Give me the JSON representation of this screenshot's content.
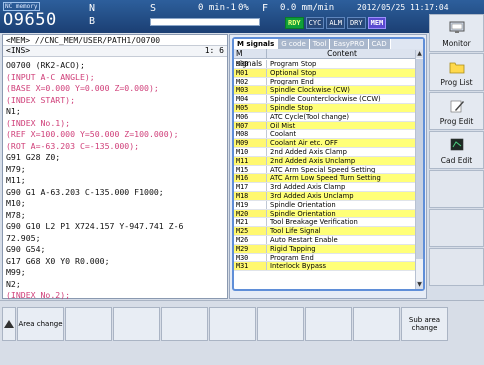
{
  "status": {
    "mem_tag": "NC memory",
    "program_no": "O9650",
    "axis_n": "N",
    "axis_b": "B",
    "axis_s": "S",
    "spindle": "0 min-1",
    "load": "0%",
    "axis_f": "F",
    "feed": "0.0 mm/min",
    "datetime": "2012/05/25 11:17:04",
    "indicators": [
      "RDY",
      "CYC",
      "ALM",
      "DRY",
      "MEM"
    ]
  },
  "program": {
    "path": "<MEM> //CNC_MEM/USER/PATH1/O0700",
    "ins": "<INS>",
    "position": "1:  6",
    "lines": [
      {
        "text": "O0700 (RK2-ACO);",
        "comment": false
      },
      {
        "text": "(INPUT A-C ANGLE);",
        "comment": true
      },
      {
        "text": "(BASE X=0.000 Y=0.000 Z=0.000);",
        "comment": true
      },
      {
        "text": "(INDEX START);",
        "comment": true
      },
      {
        "text": "N1;",
        "comment": false
      },
      {
        "text": "(INDEX No.1);",
        "comment": true
      },
      {
        "text": "(REF X=100.000 Y=50.000 Z=100.000);",
        "comment": true
      },
      {
        "text": "(ROT A=-63.203 C=-135.000);",
        "comment": true
      },
      {
        "text": "G91 G28 Z0;",
        "comment": false
      },
      {
        "text": "M79;",
        "comment": false
      },
      {
        "text": "M11;",
        "comment": false
      },
      {
        "text": "G90 G1 A-63.203 C-135.000 F1000;",
        "comment": false
      },
      {
        "text": "M10;",
        "comment": false
      },
      {
        "text": "M78;",
        "comment": false
      },
      {
        "text": "G90 G10 L2 P1 X724.157 Y-947.741 Z-6",
        "comment": false
      },
      {
        "text": "72.905;",
        "comment": false
      },
      {
        "text": "G90 G54;",
        "comment": false
      },
      {
        "text": "G17 G68 X0 Y0 R0.000;",
        "comment": false
      },
      {
        "text": "M99;",
        "comment": false
      },
      {
        "text": "N2;",
        "comment": false
      },
      {
        "text": "(INDEX No.2);",
        "comment": true
      }
    ]
  },
  "table": {
    "tabs": [
      "M signals",
      "G code",
      "Tool",
      "EasyPRO",
      "CAD"
    ],
    "headers": [
      "M signals",
      "Content"
    ],
    "rows": [
      {
        "code": "M00",
        "content": "Program Stop",
        "sel": false
      },
      {
        "code": "M01",
        "content": "Optional Stop",
        "sel": true
      },
      {
        "code": "M02",
        "content": "Program End",
        "sel": false
      },
      {
        "code": "M03",
        "content": "Spindle Clockwise (CW)",
        "sel": true
      },
      {
        "code": "M04",
        "content": "Spindle Counterclockwise (CCW)",
        "sel": false
      },
      {
        "code": "M05",
        "content": "Spindle Stop",
        "sel": true
      },
      {
        "code": "M06",
        "content": "ATC Cycle(Tool change)",
        "sel": false
      },
      {
        "code": "M07",
        "content": "Oil Mist",
        "sel": true
      },
      {
        "code": "M08",
        "content": "Coolant",
        "sel": false
      },
      {
        "code": "M09",
        "content": "Coolant Air etc. OFF",
        "sel": true
      },
      {
        "code": "M10",
        "content": "2nd Added Axis Clamp",
        "sel": false
      },
      {
        "code": "M11",
        "content": "2nd Added Axis Unclamp",
        "sel": true
      },
      {
        "code": "M15",
        "content": "ATC Arm Special Speed Setting",
        "sel": false
      },
      {
        "code": "M16",
        "content": "ATC Arm Low Speed Turn Setting",
        "sel": true
      },
      {
        "code": "M17",
        "content": "3rd Added Axis Clamp",
        "sel": false
      },
      {
        "code": "M18",
        "content": "3rd Added Axis Unclamp",
        "sel": true
      },
      {
        "code": "M19",
        "content": "Spindle Orientation",
        "sel": false
      },
      {
        "code": "M20",
        "content": "Spindle Orientation",
        "sel": true
      },
      {
        "code": "M21",
        "content": "Tool Breakage Verification",
        "sel": false
      },
      {
        "code": "M25",
        "content": "Tool Life Signal",
        "sel": true
      },
      {
        "code": "M26",
        "content": "Auto Restart Enable",
        "sel": false
      },
      {
        "code": "M29",
        "content": "Rigid Tapping",
        "sel": true
      },
      {
        "code": "M30",
        "content": "Program End",
        "sel": false
      },
      {
        "code": "M31",
        "content": "Interlock Bypass",
        "sel": true
      }
    ]
  },
  "side_keys": [
    {
      "label": "Monitor",
      "icon": "monitor-icon"
    },
    {
      "label": "Prog List",
      "icon": "folder-icon"
    },
    {
      "label": "Prog Edit",
      "icon": "pencil-icon"
    },
    {
      "label": "Cad Edit",
      "icon": "cad-icon"
    }
  ],
  "bottom_keys": {
    "area_change": "Area change",
    "sub_area_change": "Sub area change"
  },
  "colors": {
    "topbar": "#1b3f73",
    "ready": "#10a03a",
    "mem": "#5a4ad0",
    "comment": "#d0407a",
    "selected_row": "#ffff78",
    "table_border": "#5f8ed8"
  }
}
